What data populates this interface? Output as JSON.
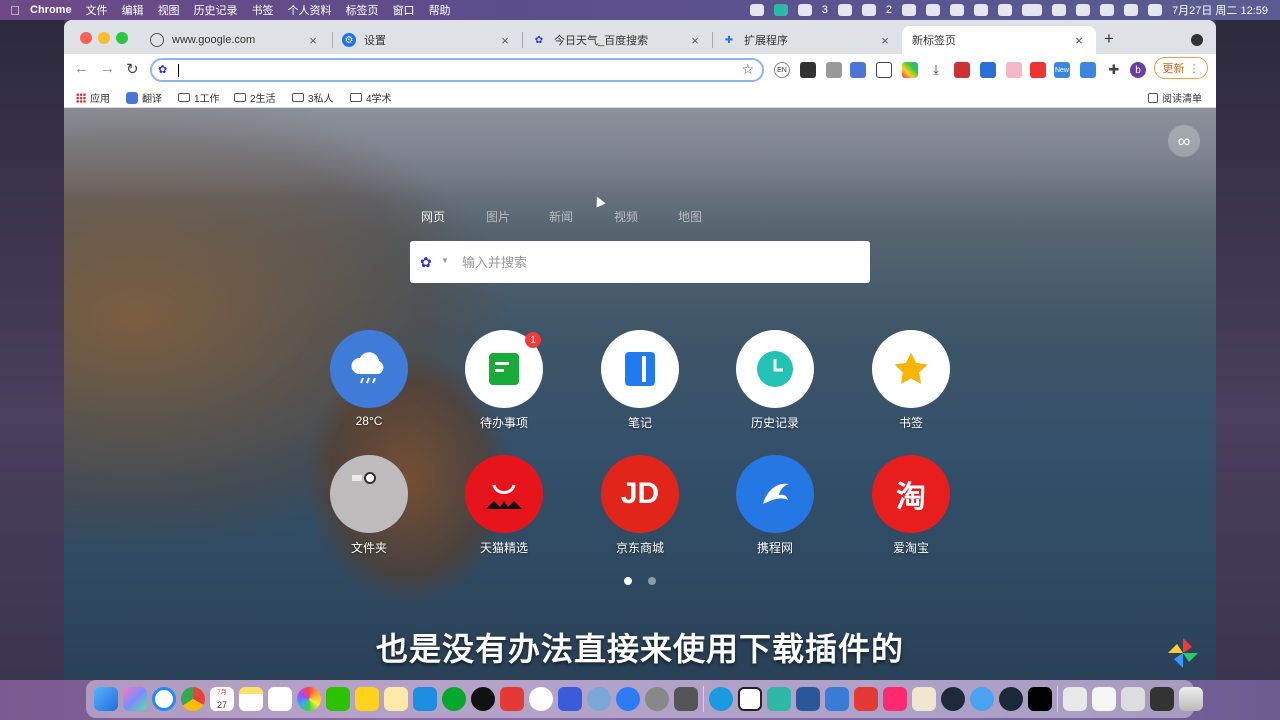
{
  "menubar": {
    "apple": "",
    "app": "Chrome",
    "menus": [
      "文件",
      "编辑",
      "视图",
      "历史记录",
      "书签",
      "个人资料",
      "标签页",
      "窗口",
      "帮助"
    ],
    "wechat_count": "3",
    "notif_count": "2",
    "datetime": "7月27日 周二  12:59"
  },
  "tabs": [
    {
      "label": "www.google.com",
      "close": "×"
    },
    {
      "label": "设置",
      "close": "×"
    },
    {
      "label": "今日天气_百度搜索",
      "close": "×"
    },
    {
      "label": "扩展程序",
      "close": "×"
    },
    {
      "label": "新标签页",
      "close": "×",
      "active": true
    }
  ],
  "new_tab": "+",
  "toolbar": {
    "back": "←",
    "forward": "→",
    "reload": "↻",
    "url": "",
    "star": "☆",
    "update_label": "更新",
    "update_more": "⋮",
    "ext_en": "EN",
    "ext_new": "New",
    "profile": "b"
  },
  "bookmarks": {
    "apps": "应用",
    "translate": "翻译",
    "folders": [
      "1工作",
      "2生活",
      "3私人",
      "4学术"
    ],
    "reading_list": "阅读清单"
  },
  "newtab": {
    "stamp": "∞",
    "search_tabs": [
      "网页",
      "图片",
      "新闻",
      "视频",
      "地图"
    ],
    "search_placeholder": "输入并搜索",
    "shortcuts_row1": [
      {
        "label": "28°C",
        "icon": "cloud-rain-icon",
        "color": "#3f7bd8"
      },
      {
        "label": "待办事项",
        "icon": "todo-icon",
        "color": "#ffffff",
        "badge": "1"
      },
      {
        "label": "笔记",
        "icon": "notebook-icon",
        "color": "#ffffff"
      },
      {
        "label": "历史记录",
        "icon": "clock-icon",
        "color": "#ffffff"
      },
      {
        "label": "书签",
        "icon": "star-icon",
        "color": "#ffffff"
      }
    ],
    "shortcuts_row2": [
      {
        "label": "文件夹",
        "icon": "folder-icon",
        "color": "#bdbbbb"
      },
      {
        "label": "天猫精选",
        "icon": "tmall-icon",
        "color": "#e8141c"
      },
      {
        "label": "京东商城",
        "icon": "jd-icon",
        "color": "#e1251b",
        "glyph": "JD"
      },
      {
        "label": "携程网",
        "icon": "ctrip-icon",
        "color": "#2577e3"
      },
      {
        "label": "爱淘宝",
        "icon": "taobao-icon",
        "color": "#e81d1d",
        "glyph": "淘"
      }
    ],
    "page": "1/2",
    "subtitle": "也是没有办法直接来使用下载插件的"
  },
  "dock": {
    "calendar_day": "27",
    "calendar_month": "7月"
  }
}
